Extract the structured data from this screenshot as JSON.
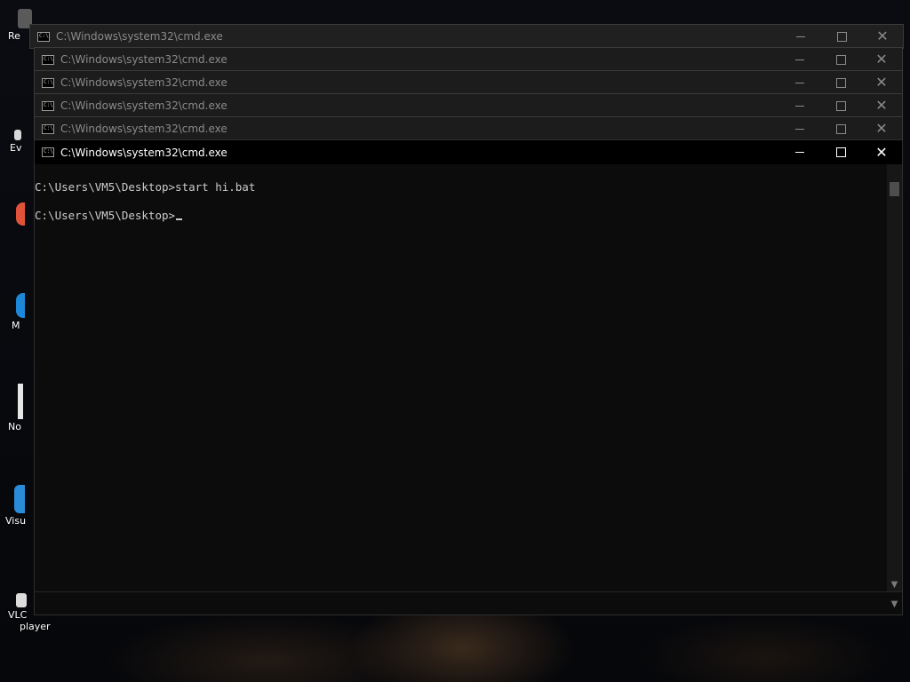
{
  "desktop": {
    "icons": [
      {
        "label": "Re",
        "icon": "recycle-bin-icon"
      },
      {
        "label": "Ev",
        "icon": "app-shortcut-icon"
      },
      {
        "label": "",
        "icon": "browser-icon"
      },
      {
        "label": "M",
        "icon": "edge-icon"
      },
      {
        "label": "No",
        "icon": "notepad-icon"
      },
      {
        "label": "Visu",
        "icon": "visual-studio-icon"
      },
      {
        "label": "VLC",
        "sub": "player",
        "icon": "vlc-icon"
      }
    ]
  },
  "windows": [
    {
      "title": "C:\\Windows\\system32\\cmd.exe"
    },
    {
      "title": "C:\\Windows\\system32\\cmd.exe"
    },
    {
      "title": "C:\\Windows\\system32\\cmd.exe"
    },
    {
      "title": "C:\\Windows\\system32\\cmd.exe"
    },
    {
      "title": "C:\\Windows\\system32\\cmd.exe"
    }
  ],
  "active_window": {
    "title": "C:\\Windows\\system32\\cmd.exe",
    "icon": "cmd-icon",
    "icon_text": "C:\\",
    "lines": [
      "C:\\Users\\VM5\\Desktop>start hi.bat",
      "C:\\Users\\VM5\\Desktop>"
    ]
  },
  "colors": {
    "console_bg": "#0c0c0c",
    "console_text": "#cccccc",
    "inactive_title_text": "#8a8a8a"
  }
}
